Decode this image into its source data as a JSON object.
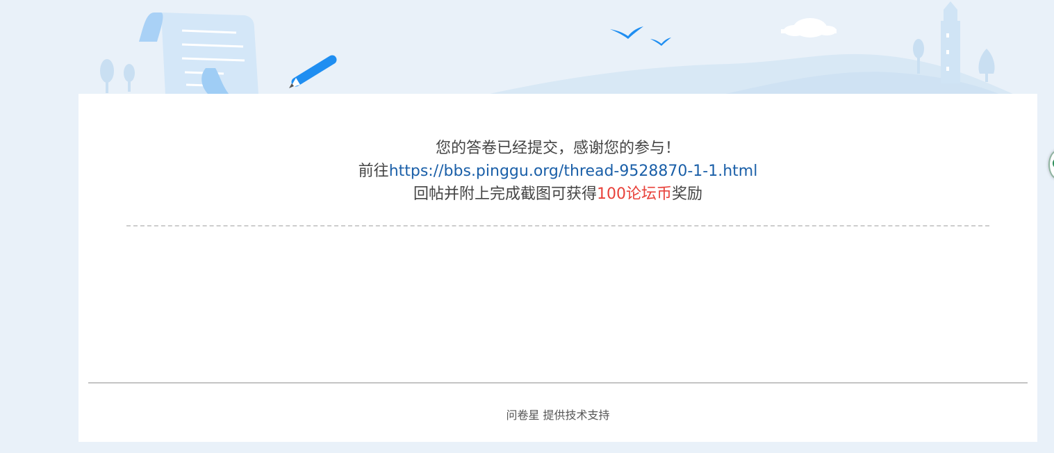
{
  "message": {
    "thanks": "您的答卷已经提交，感谢您的参与！",
    "goto_prefix": "前往",
    "goto_link": "https://bbs.pinggu.org/thread-9528870-1-1.html",
    "reward_prefix": "回帖并附上完成截图可获得",
    "reward_amount": "100论坛币",
    "reward_suffix": "奖励"
  },
  "footer": {
    "brand": "问卷星",
    "support": " 提供技术支持"
  },
  "colors": {
    "background": "#e9f1f9",
    "link": "#1a5fa8",
    "reward": "#e8413a",
    "text": "#444444"
  },
  "icons": [
    "scroll-illustration",
    "pen-icon",
    "bird-icon",
    "cloud-icon",
    "lighthouse-icon",
    "tree-icon"
  ]
}
